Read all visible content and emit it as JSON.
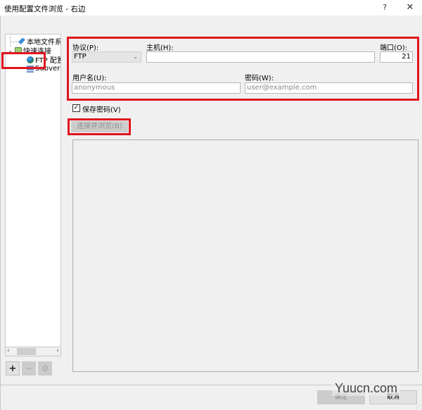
{
  "window": {
    "title": "使用配置文件浏览 - 右边",
    "help_icon": "?",
    "close_icon": "✕"
  },
  "tree": {
    "items": [
      {
        "label": "本地文件系",
        "icon": "local-drive-icon"
      },
      {
        "label": "快速连接",
        "icon": "quick-connect-icon",
        "expanded": true
      },
      {
        "label": "FTP 配置",
        "icon": "ftp-globe-icon",
        "selected": true
      },
      {
        "label": "Subversi",
        "icon": "subversion-icon"
      }
    ],
    "chevron": "⌄",
    "scroll_left": "‹",
    "scroll_right": "›",
    "add_label": "+",
    "remove_label": "−",
    "settings_label": "⚙"
  },
  "form": {
    "protocol_label": "协议(P):",
    "protocol_value": "FTP",
    "protocol_arrow": "⌄",
    "host_label": "主机(H):",
    "host_value": "",
    "port_label": "端口(O):",
    "port_value": "21",
    "username_label": "用户名(U):",
    "username_placeholder": "anonymous",
    "password_label": "密码(W):",
    "password_placeholder": "user@example.com",
    "save_password_label": "保存密码(V)",
    "save_password_checked": true,
    "checkmark": "✓",
    "connect_label": "连接并浏览(B)"
  },
  "footer": {
    "ok_label": "确定",
    "cancel_label": "取消",
    "watermark": "Yuucn.com"
  },
  "colors": {
    "highlight_red": "#e0141e",
    "background": "#f0f0f0"
  }
}
